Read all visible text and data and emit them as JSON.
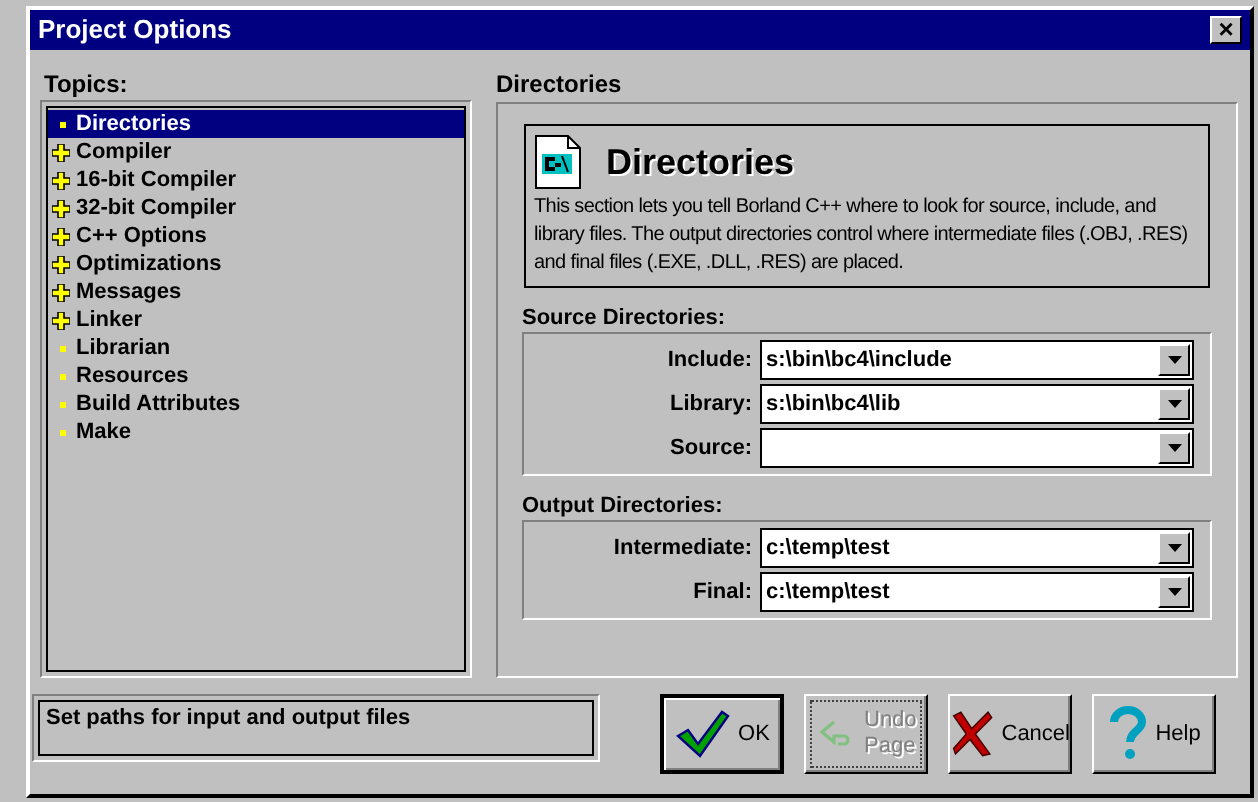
{
  "window": {
    "title": "Project Options",
    "close": "×"
  },
  "topics": {
    "label": "Topics:",
    "items": [
      {
        "label": "Directories",
        "kind": "leaf",
        "selected": true
      },
      {
        "label": "Compiler",
        "kind": "branch",
        "selected": false
      },
      {
        "label": "16-bit Compiler",
        "kind": "branch",
        "selected": false
      },
      {
        "label": "32-bit Compiler",
        "kind": "branch",
        "selected": false
      },
      {
        "label": "C++ Options",
        "kind": "branch",
        "selected": false
      },
      {
        "label": "Optimizations",
        "kind": "branch",
        "selected": false
      },
      {
        "label": "Messages",
        "kind": "branch",
        "selected": false
      },
      {
        "label": "Linker",
        "kind": "branch",
        "selected": false
      },
      {
        "label": "Librarian",
        "kind": "leaf",
        "selected": false
      },
      {
        "label": "Resources",
        "kind": "leaf",
        "selected": false
      },
      {
        "label": "Build Attributes",
        "kind": "leaf",
        "selected": false
      },
      {
        "label": "Make",
        "kind": "leaf",
        "selected": false
      }
    ]
  },
  "page": {
    "title": "Directories",
    "heading": "Directories",
    "description": "This section lets you tell Borland C++ where to look for source, include, and library files.  The output directories control where intermediate files (.OBJ, .RES) and final files (.EXE, .DLL, .RES) are placed.",
    "groups": [
      {
        "label": "Source Directories:",
        "fields": [
          {
            "label": "Include:",
            "value": "s:\\bin\\bc4\\include"
          },
          {
            "label": "Library:",
            "value": "s:\\bin\\bc4\\lib"
          },
          {
            "label": "Source:"
          }
        ]
      },
      {
        "label": "Output Directories:",
        "fields": [
          {
            "label": "Intermediate:",
            "value": "c:\\temp\\test"
          },
          {
            "label": "Final:",
            "value": "c:\\temp\\test"
          }
        ]
      }
    ]
  },
  "status": "Set paths for input and output files",
  "buttons": [
    {
      "label": "OK",
      "kind": "ok",
      "default": true,
      "disabled": false
    },
    {
      "label": "Undo Page",
      "kind": "undo",
      "default": false,
      "disabled": true
    },
    {
      "label": "Cancel",
      "kind": "cancel",
      "default": false,
      "disabled": false
    },
    {
      "label": "Help",
      "kind": "help",
      "default": false,
      "disabled": false
    }
  ]
}
